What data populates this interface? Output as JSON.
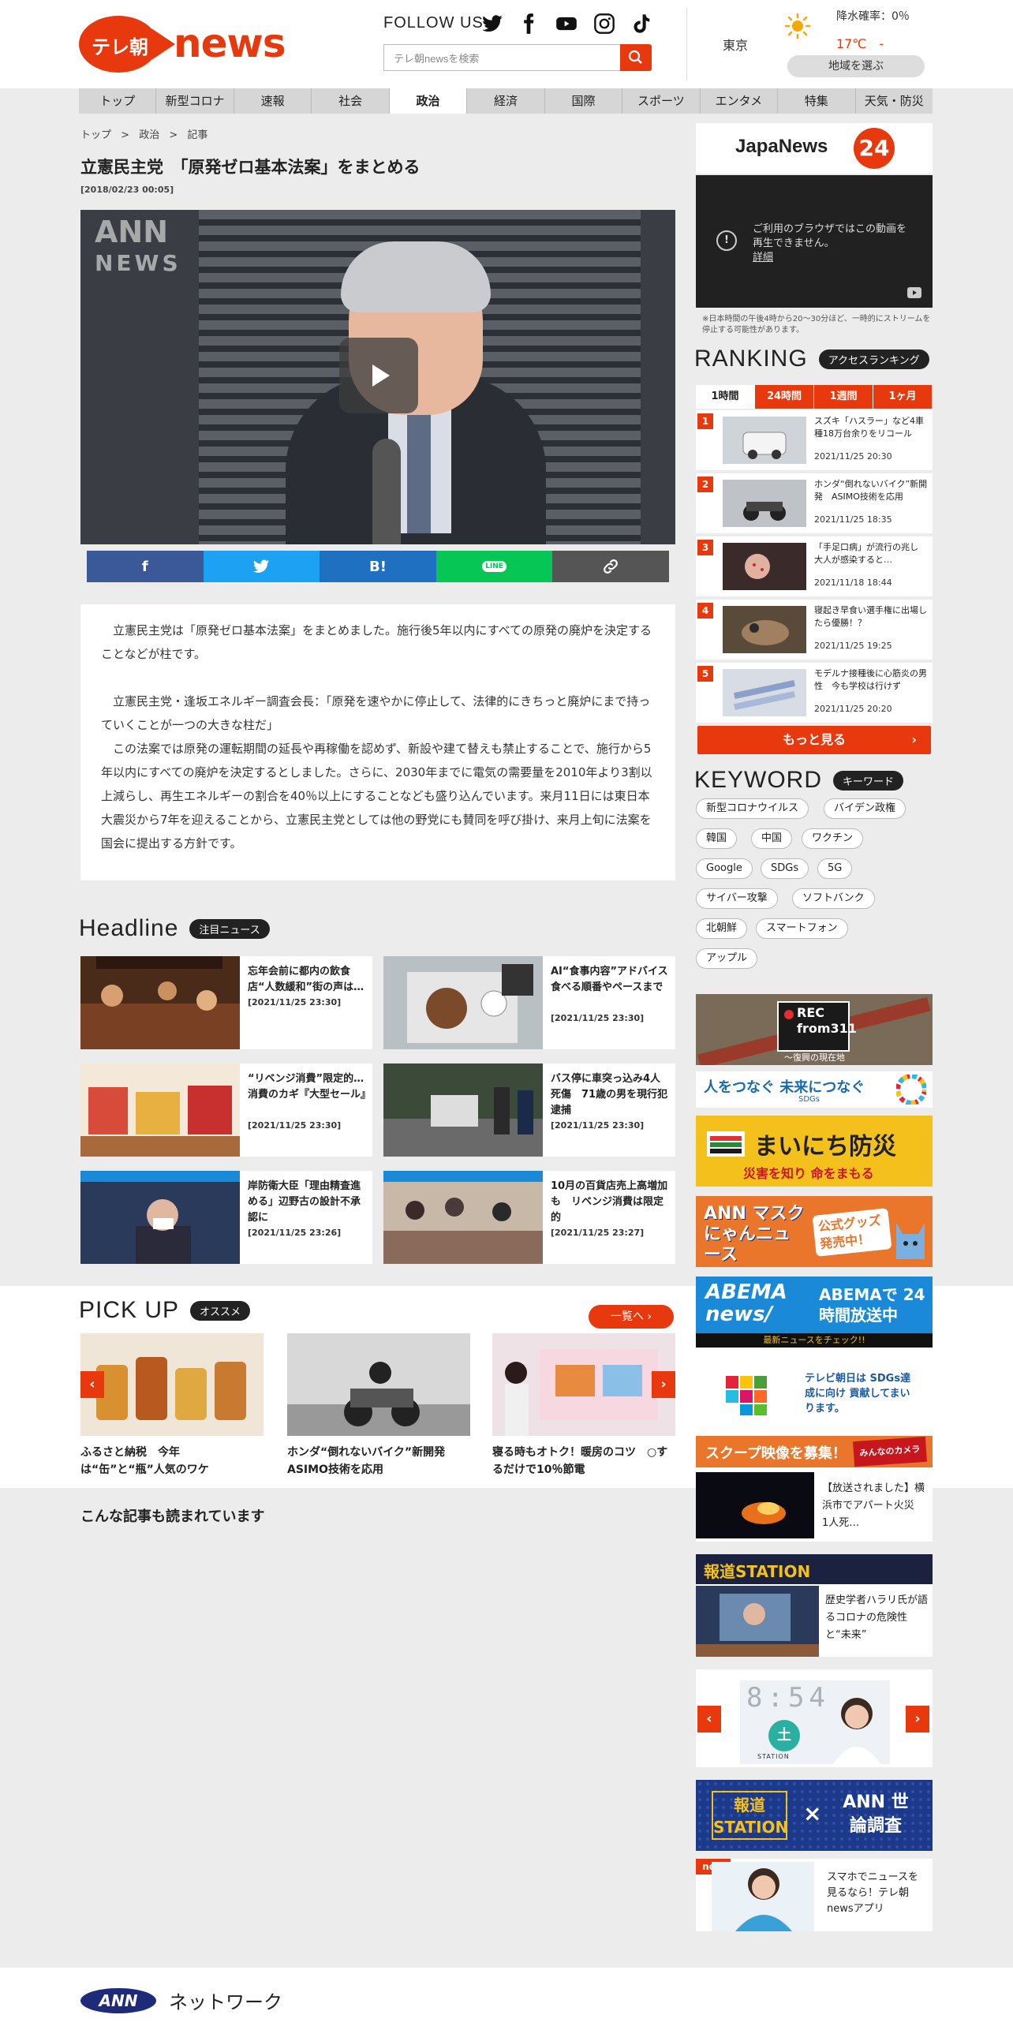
{
  "header": {
    "logo_text": "テレ朝",
    "logo_news": "news",
    "follow_us": "FOLLOW US",
    "search_placeholder": "テレ朝newsを検索",
    "city": "東京",
    "rain_prob": "降水確率：0％",
    "temperature": "17℃",
    "temp_dash": "-",
    "region_button": "地域を選ぶ"
  },
  "nav": [
    "トップ",
    "新型コロナ",
    "速報",
    "社会",
    "政治",
    "経済",
    "国際",
    "スポーツ",
    "エンタメ",
    "特集",
    "天気・防災"
  ],
  "nav_active_index": 4,
  "breadcrumb": [
    "トップ",
    "政治",
    "記事"
  ],
  "article": {
    "title": "立憲民主党　「原発ゼロ基本法案」をまとめる",
    "date": "[2018/02/23 00:05]",
    "video_watermark": "ANN",
    "video_watermark_sub": "NEWS",
    "p1": "　立憲民主党は「原発ゼロ基本法案」をまとめました。施行後5年以内にすべての原発の廃炉を決定することなどが柱です。",
    "p2": "　立憲民主党・逢坂エネルギー調査会長：「原発を速やかに停止して、法律的にきちっと廃炉にまで持っていくことが一つの大きな柱だ」",
    "p3": "　この法案では原発の運転期間の延長や再稼働を認めず、新設や建て替えも禁止することで、施行から5年以内にすべての廃炉を決定するとしました。さらに、2030年までに電気の需要量を2010年より3割以上減らし、再生エネルギーの割合を40％以上にすることなども盛り込んでいます。来月11日には東日本大震災から7年を迎えることから、立憲民主党としては他の野党にも賛同を呼び掛け、来月上旬に法案を国会に提出する方針です。"
  },
  "share": {
    "facebook": "f",
    "hatena": "B!",
    "line": "LINE",
    "colors": {
      "facebook": "#3b5998",
      "twitter": "#1da1f2",
      "hatena": "#1f70c1",
      "line": "#06c755",
      "link": "#555555"
    }
  },
  "headline": {
    "title": "Headline",
    "badge": "注目ニュース",
    "items": [
      {
        "title": "忘年会前に都内の飲食店“人数緩和”街の声は…",
        "date": "[2021/11/25 23:30]"
      },
      {
        "title": "AI“食事内容”アドバイス　食べる順番やペースまで",
        "date": "[2021/11/25 23:30]"
      },
      {
        "title": "“リベンジ消費”限定的…消費のカギ『大型セール』",
        "date": "[2021/11/25 23:30]"
      },
      {
        "title": "バス停に車突っ込み4人死傷　71歳の男を現行犯逮捕",
        "date": "[2021/11/25 23:30]"
      },
      {
        "title": "岸防衛大臣「理由精査進める」辺野古の設計不承認に",
        "date": "[2021/11/25 23:26]"
      },
      {
        "title": "10月の百貨店売上高増加も　リベンジ消費は限定的",
        "date": "[2021/11/25 23:27]"
      }
    ]
  },
  "pickup": {
    "title": "PICK UP",
    "badge": "オススメ",
    "more": "一覧へ ›",
    "items": [
      {
        "title": "ふるさと納税　今年は“缶”と“瓶”人気のワケ"
      },
      {
        "title": "ホンダ“倒れないバイク”新開発　ASIMO技術を応用"
      },
      {
        "title": "寝る時もオトク！暖房のコツ　○するだけで10％節電"
      }
    ]
  },
  "related_title": "こんな記事も読まれています",
  "sidebar": {
    "japanews": "JapaNews",
    "japanews_24": "24",
    "video_error": "ご利用のブラウザではこの動画を再生できません。",
    "video_error_link": "詳細",
    "stream_note": "※日本時間の午後4時から20～30分ほど、一時的にストリームを停止する可能性があります。",
    "ranking_title": "RANKING",
    "ranking_badge": "アクセスランキング",
    "ranking_tabs": [
      "1時間",
      "24時間",
      "1週間",
      "1ヶ月"
    ],
    "ranking": [
      {
        "num": "1",
        "title": "スズキ「ハスラー」など4車種18万台余りをリコール",
        "date": "2021/11/25 20:30"
      },
      {
        "num": "2",
        "title": "ホンダ“倒れないバイク”新開発　ASIMO技術を応用",
        "date": "2021/11/25 18:35"
      },
      {
        "num": "3",
        "title": "「手足口病」が流行の兆し　大人が感染すると…",
        "date": "2021/11/18 18:44"
      },
      {
        "num": "4",
        "title": "寝起き早食い選手権に出場したら優勝！？",
        "date": "2021/11/25 19:25"
      },
      {
        "num": "5",
        "title": "モデルナ接種後に心筋炎の男性　今も学校は行けず",
        "date": "2021/11/25 20:20"
      }
    ],
    "more_button": "もっと見る",
    "keyword_title": "KEYWORD",
    "keyword_badge": "キーワード",
    "keywords": [
      "新型コロナウイルス",
      "バイデン政権",
      "韓国",
      "中国",
      "ワクチン",
      "Google",
      "SDGs",
      "5G",
      "サイバー攻撃",
      "ソフトバンク",
      "北朝鮮",
      "スマートフォン",
      "アップル"
    ],
    "banners": {
      "rec": "REC from311",
      "rec_sub": "～復興の現在地",
      "sdgs": "人をつなぐ 未来につなぐ",
      "sdgs_sub": "SDGs",
      "bousai": "まいにち防災",
      "bousai_sub": "災害を知り 命をまもる",
      "mask": "ANN マスクにゃんニュース",
      "mask_sub": "公式グッズ発売中！",
      "abema": "ABEMA news/",
      "abema_right": "ABEMAで 24時間放送中",
      "abema_sub": "最新ニュースをチェック!!",
      "sdgs2": "テレビ朝日は SDGs達成に向け 貢献してまいります。",
      "scoop_title": "スクープ映像を募集！",
      "scoop_logo": "みんなのカメラ",
      "scoop_text": "【放送されました】横浜市でアパート火災　1人死…",
      "station_title": "報道STATION",
      "station_text": "歴史学者ハラリ氏が語るコロナの危険性と“未来”",
      "clock": "8:54",
      "clock_station": "土",
      "clock_station_sub": "STATION",
      "poll_left": "報道 STATION",
      "poll_x": "×",
      "poll_right": "ANN 世論調査",
      "app_new": "new",
      "app_text": "スマホでニュースを見るなら！テレ朝newsアプリ"
    }
  },
  "footer": {
    "ann": "ANN",
    "network": "ネットワーク"
  }
}
